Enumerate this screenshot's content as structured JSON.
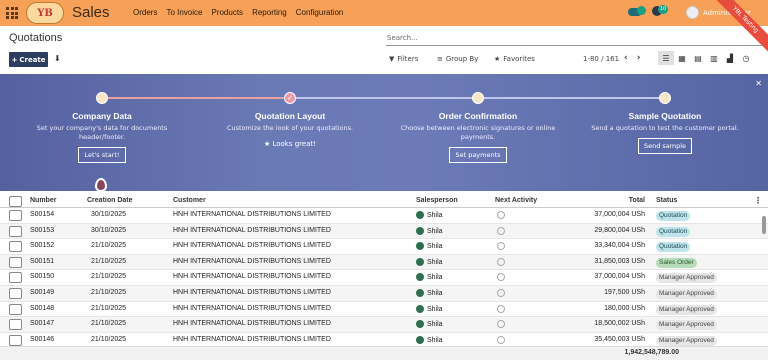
{
  "topbar": {
    "logo": "YB",
    "app": "Sales",
    "menu": [
      "Orders",
      "To Invoice",
      "Products",
      "Reporting",
      "Configuration"
    ],
    "chat_count": "",
    "activity_count": "10",
    "user": "Administrator",
    "ribbon": "YBL Testing"
  },
  "page": {
    "title": "Quotations",
    "search_placeholder": "Search...",
    "create": "Create",
    "filters": "Filters",
    "group_by": "Group By",
    "favorites": "Favorites",
    "pager": "1-80 / 161"
  },
  "onboarding": {
    "steps": [
      {
        "title": "Company Data",
        "desc": "Set your company's data for documents header/footer.",
        "button": "Let's start!"
      },
      {
        "title": "Quotation Layout",
        "desc": "Customize the look of your quotations.",
        "note": "Looks great!"
      },
      {
        "title": "Order Confirmation",
        "desc": "Choose between electronic signatures or online payments.",
        "button": "Set payments"
      },
      {
        "title": "Sample Quotation",
        "desc": "Send a quotation to test the customer portal.",
        "button": "Send sample"
      }
    ]
  },
  "table": {
    "headers": {
      "number": "Number",
      "date": "Creation Date",
      "customer": "Customer",
      "salesperson": "Salesperson",
      "activity": "Next Activity",
      "total": "Total",
      "status": "Status"
    },
    "rows": [
      {
        "number": "S00154",
        "date": "30/10/2025",
        "customer": "HNH INTERNATIONAL DISTRIBUTIONS LIMITED",
        "salesperson": "Shila",
        "total": "37,000,004 USh",
        "status": "Quotation",
        "kind": "q"
      },
      {
        "number": "S00153",
        "date": "30/10/2025",
        "customer": "HNH INTERNATIONAL DISTRIBUTIONS LIMITED",
        "salesperson": "Shila",
        "total": "29,800,004 USh",
        "status": "Quotation",
        "kind": "q"
      },
      {
        "number": "S00152",
        "date": "21/10/2025",
        "customer": "HNH INTERNATIONAL DISTRIBUTIONS LIMITED",
        "salesperson": "Shila",
        "total": "33,340,004 USh",
        "status": "Quotation",
        "kind": "q"
      },
      {
        "number": "S00151",
        "date": "21/10/2025",
        "customer": "HNH INTERNATIONAL DISTRIBUTIONS LIMITED",
        "salesperson": "Shila",
        "total": "31,850,003 USh",
        "status": "Sales Order",
        "kind": "so"
      },
      {
        "number": "S00150",
        "date": "21/10/2025",
        "customer": "HNH INTERNATIONAL DISTRIBUTIONS LIMITED",
        "salesperson": "Shila",
        "total": "37,000,004 USh",
        "status": "Manager Approved",
        "kind": "ma"
      },
      {
        "number": "S00149",
        "date": "21/10/2025",
        "customer": "HNH INTERNATIONAL DISTRIBUTIONS LIMITED",
        "salesperson": "Shila",
        "total": "197,500 USh",
        "status": "Manager Approved",
        "kind": "ma"
      },
      {
        "number": "S00148",
        "date": "21/10/2025",
        "customer": "HNH INTERNATIONAL DISTRIBUTIONS LIMITED",
        "salesperson": "Shila",
        "total": "180,000 USh",
        "status": "Manager Approved",
        "kind": "ma"
      },
      {
        "number": "S00147",
        "date": "21/10/2025",
        "customer": "HNH INTERNATIONAL DISTRIBUTIONS LIMITED",
        "salesperson": "Shila",
        "total": "18,500,002 USh",
        "status": "Manager Approved",
        "kind": "ma"
      },
      {
        "number": "S00146",
        "date": "21/10/2025",
        "customer": "HNH INTERNATIONAL DISTRIBUTIONS LIMITED",
        "salesperson": "Shila",
        "total": "35,450,003 USh",
        "status": "Manager Approved",
        "kind": "ma"
      }
    ],
    "grand_total": "1,942,548,789.00"
  }
}
